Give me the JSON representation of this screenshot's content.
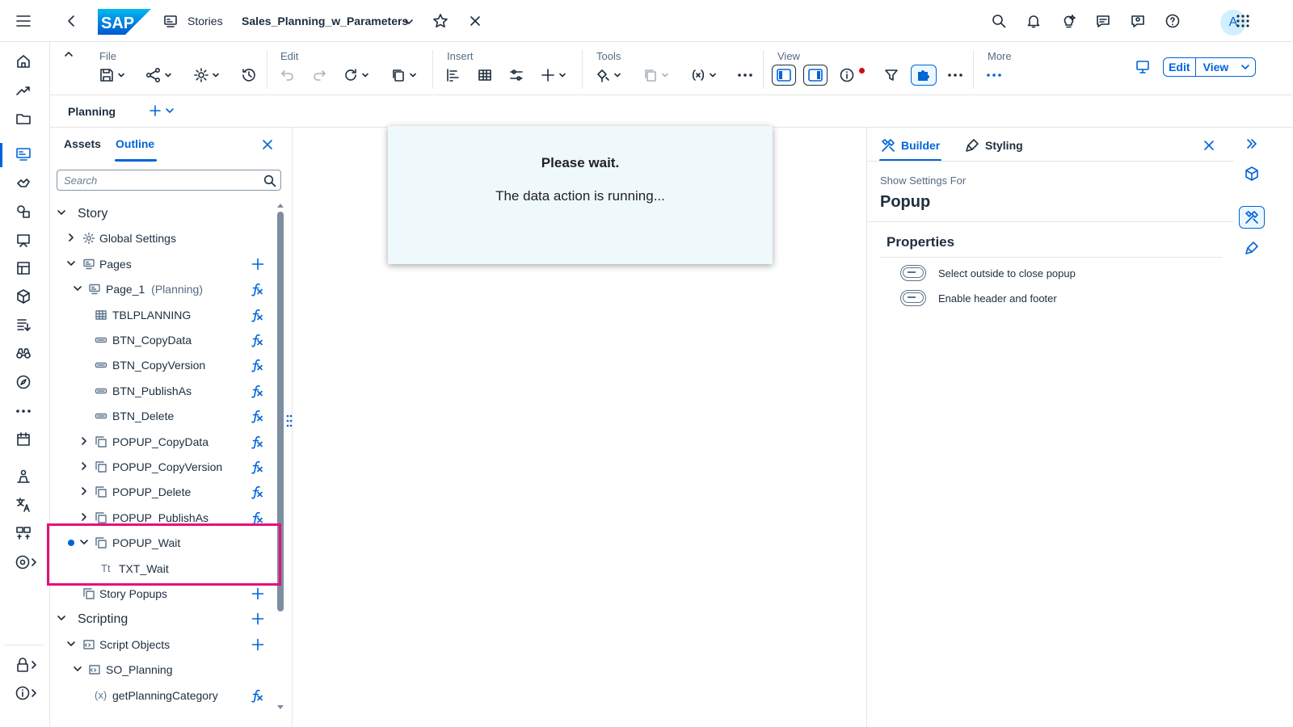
{
  "shell": {
    "logo": "SAP",
    "breadcrumb": "Stories",
    "story_title": "Sales_Planning_w_Parameters",
    "avatar_initial": "A"
  },
  "toolbar": {
    "groups": {
      "file": "File",
      "edit": "Edit",
      "insert": "Insert",
      "tools": "Tools",
      "view": "View",
      "more": "More"
    },
    "mode_edit": "Edit",
    "mode_view": "View"
  },
  "pagebar": {
    "page_label": "Planning"
  },
  "left_panel": {
    "tabs": [
      "Assets",
      "Outline"
    ],
    "active_tab": "Outline",
    "search_placeholder": "Search",
    "tree": [
      {
        "label": "Story",
        "icon": "none",
        "expander": "down"
      },
      {
        "label": "Global Settings",
        "icon": "gear-icon",
        "expander": "right"
      },
      {
        "label": "Pages",
        "icon": "page-icon",
        "expander": "down",
        "action": "add"
      },
      {
        "label": "Page_1",
        "suffix": "(Planning)",
        "icon": "page-icon",
        "expander": "down",
        "action": "fx"
      },
      {
        "label": "TBLPLANNING",
        "icon": "table-icon",
        "action": "fx"
      },
      {
        "label": "BTN_CopyData",
        "icon": "button-icon",
        "action": "fx"
      },
      {
        "label": "BTN_CopyVersion",
        "icon": "button-icon",
        "action": "fx"
      },
      {
        "label": "BTN_PublishAs",
        "icon": "button-icon",
        "action": "fx"
      },
      {
        "label": "BTN_Delete",
        "icon": "button-icon",
        "action": "fx"
      },
      {
        "label": "POPUP_CopyData",
        "icon": "popup-icon",
        "expander": "right",
        "action": "fx"
      },
      {
        "label": "POPUP_CopyVersion",
        "icon": "popup-icon",
        "expander": "right",
        "action": "fx"
      },
      {
        "label": "POPUP_Delete",
        "icon": "popup-icon",
        "expander": "right",
        "action": "fx"
      },
      {
        "label": "POPUP_PublishAs",
        "icon": "popup-icon",
        "expander": "right",
        "action": "fx"
      },
      {
        "label": "POPUP_Wait",
        "icon": "popup-icon",
        "expander": "down",
        "selected_dot": true
      },
      {
        "label": "TXT_Wait",
        "icon": "text-icon",
        "icon_text": "Tt"
      },
      {
        "label": "Story Popups",
        "icon": "popup-icon",
        "action": "add"
      },
      {
        "label": "Scripting",
        "icon": "none",
        "expander": "down",
        "action": "add"
      },
      {
        "label": "Script Objects",
        "icon": "script-icon",
        "expander": "down",
        "action": "add"
      },
      {
        "label": "SO_Planning",
        "icon": "script-icon",
        "expander": "down"
      },
      {
        "label": "getPlanningCategory",
        "icon": "function-icon",
        "icon_text": "(x)",
        "action": "fx"
      }
    ]
  },
  "canvas": {
    "popup_title": "Please wait.",
    "popup_message": "The data action is running..."
  },
  "right_panel": {
    "tabs": [
      "Builder",
      "Styling"
    ],
    "active_tab": "Builder",
    "settings_for_label": "Show Settings For",
    "settings_object": "Popup",
    "section_title": "Properties",
    "options": [
      {
        "label": "Select outside to close popup",
        "on": false
      },
      {
        "label": "Enable header and footer",
        "on": false
      }
    ]
  },
  "colors": {
    "accent": "#0064d9",
    "highlight_frame": "#e5107b",
    "popup_bg": "#eff8fb",
    "text": "#1d2d3e"
  }
}
